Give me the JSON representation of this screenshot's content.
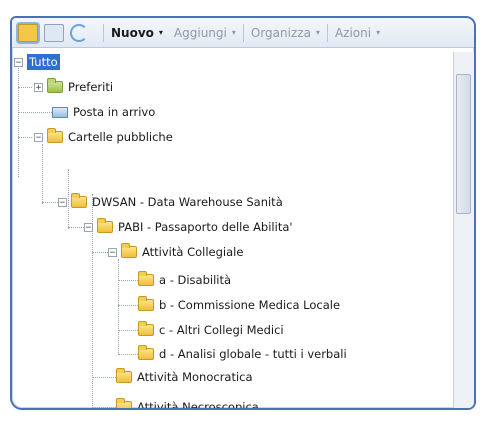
{
  "toolbar": {
    "nuovo_label": "Nuovo",
    "aggiungi_label": "Aggiungi",
    "organizza_label": "Organizza",
    "azioni_label": "Azioni",
    "dropdown_glyph": "▾",
    "icons": [
      "folder-view-icon",
      "tree-view-icon",
      "refresh-icon"
    ]
  },
  "tree": {
    "root": "Tutto",
    "preferiti": "Preferiti",
    "posta": "Posta in arrivo",
    "cartelle": "Cartelle pubbliche",
    "dwsan": "DWSAN - Data Warehouse Sanità",
    "pabi": "PABI - Passaporto delle Abilita'",
    "collegiale": "Attività Collegiale",
    "disabilita": "a - Disabilità",
    "commissione": "b - Commissione Medica Locale",
    "collegi": "c - Altri Collegi Medici",
    "analisi": "d - Analisi globale - tutti i verbali",
    "monocratica": "Attività Monocratica",
    "necroscopica": "Attività Necroscopica",
    "expand_glyph": "+",
    "collapse_glyph": "−"
  },
  "colors": {
    "frame": "#4a72b8",
    "selection": "#2f6fd0",
    "folder": "#f0bf3a"
  }
}
